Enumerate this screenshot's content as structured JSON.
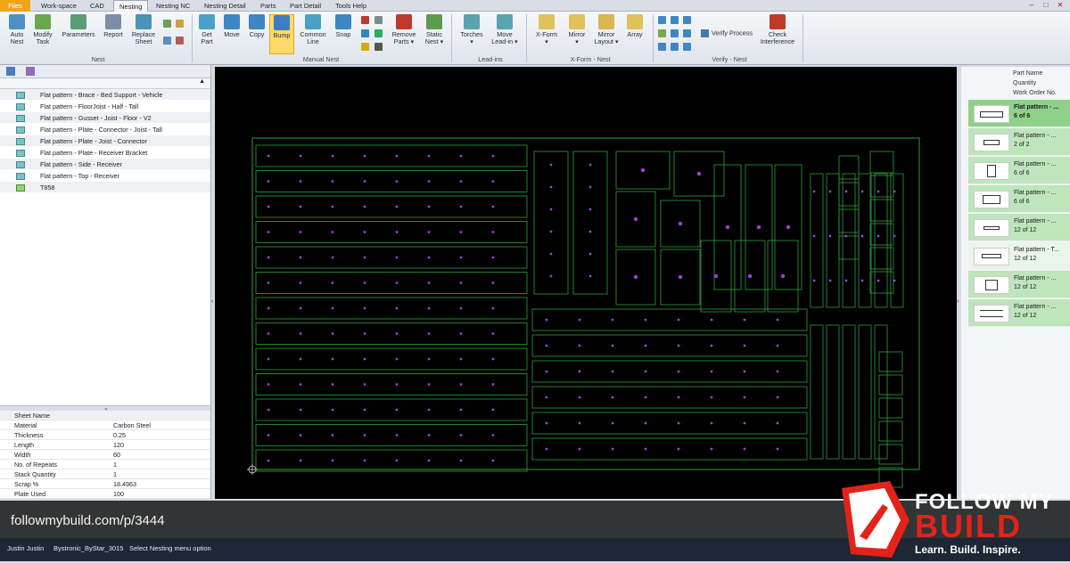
{
  "menubar": {
    "tabs": [
      "Files",
      "Work-space",
      "CAD",
      "Nesting",
      "Nesting NC",
      "Nesting Detail",
      "Parts",
      "Part Detail",
      "Tools Help"
    ],
    "active": "Nesting"
  },
  "ribbon": {
    "buttons": {
      "auto_nest": "Auto\nNest",
      "modify_task": "Modify\nTask",
      "parameters": "Parameters",
      "report": "Report",
      "replace_sheet": "Replace\nSheet",
      "get_part": "Get\nPart",
      "move": "Move",
      "copy": "Copy",
      "bump": "Bump",
      "common_line": "Common\nLine",
      "snap": "Snap",
      "remove_parts": "Remove\nParts ▾",
      "static_nest": "Static\nNest ▾",
      "torches": "Torches\n▾",
      "move_lead_in": "Move\nLead-in ▾",
      "x_form": "X-Form\n▾",
      "mirror": "Mirror\n▾",
      "mirror_layout": "Mirror\nLayout ▾",
      "array": "Array",
      "verify_process": "Verify Process",
      "check_interference": "Check\nInterference"
    },
    "groups": [
      "Nest",
      "Manual Nest",
      "Lead-ins",
      "X-Form - Nest",
      "Verify - Nest"
    ]
  },
  "parts_list": [
    "Flat pattern - Brace - Bed Support - Vehicle",
    "Flat pattern - FloorJoist - Half - Tall",
    "Flat pattern - Gusset - Joist - Floor - V2",
    "Flat pattern - Plate - Connector - Joist - Tall",
    "Flat pattern - Plate - Joist - Connector",
    "Flat pattern - Plate - Receiver Bracket",
    "Flat pattern - Side - Receiver",
    "Flat pattern - Top - Receiver",
    "T858"
  ],
  "properties": {
    "header": "Sheet Name",
    "rows": [
      {
        "k": "Material",
        "v": "Carbon Steel"
      },
      {
        "k": "Thickness",
        "v": "0.25"
      },
      {
        "k": "Length",
        "v": "120"
      },
      {
        "k": "Width",
        "v": "60"
      },
      {
        "k": "No. of Repeats",
        "v": "1"
      },
      {
        "k": "Stack Quantity",
        "v": "1"
      },
      {
        "k": "Scrap %",
        "v": "18.4963"
      },
      {
        "k": "Plate Used",
        "v": "100"
      }
    ]
  },
  "right_panel": {
    "headers": [
      "Part Name",
      "Quantity",
      "Work Order No."
    ],
    "rows": [
      {
        "name": "Flat pattern - ...",
        "qty": "6 of 6",
        "selected": true
      },
      {
        "name": "Flat pattern - ...",
        "qty": "2 of 2",
        "selected": false
      },
      {
        "name": "Flat pattern - ...",
        "qty": "6 of 6",
        "selected": false
      },
      {
        "name": "Flat pattern - ...",
        "qty": "6 of 6",
        "selected": false
      },
      {
        "name": "Flat pattern - ...",
        "qty": "12 of 12",
        "selected": false
      },
      {
        "name": "Flat pattern - T...",
        "qty": "12 of 12",
        "selected": false
      },
      {
        "name": "Flat pattern - ...",
        "qty": "12 of 12",
        "selected": false
      },
      {
        "name": "Flat pattern - ...",
        "qty": "12 of 12",
        "selected": false
      }
    ]
  },
  "overlay": {
    "url": "followmybuild.com/p/3444"
  },
  "status": {
    "user": "Justin Justin",
    "machine": "Bystronic_ByStar_3015",
    "message": "Select Nesting menu option"
  },
  "brand": {
    "line1": "FOLLOW MY",
    "line2": "BUILD",
    "tagline": "Learn. Build. Inspire."
  },
  "colors": {
    "accent": "#f0a516",
    "part_outline": "#2fa13a",
    "holes": "#a43fd8",
    "selection": "#8fd08a",
    "brand_red": "#e2231a"
  }
}
